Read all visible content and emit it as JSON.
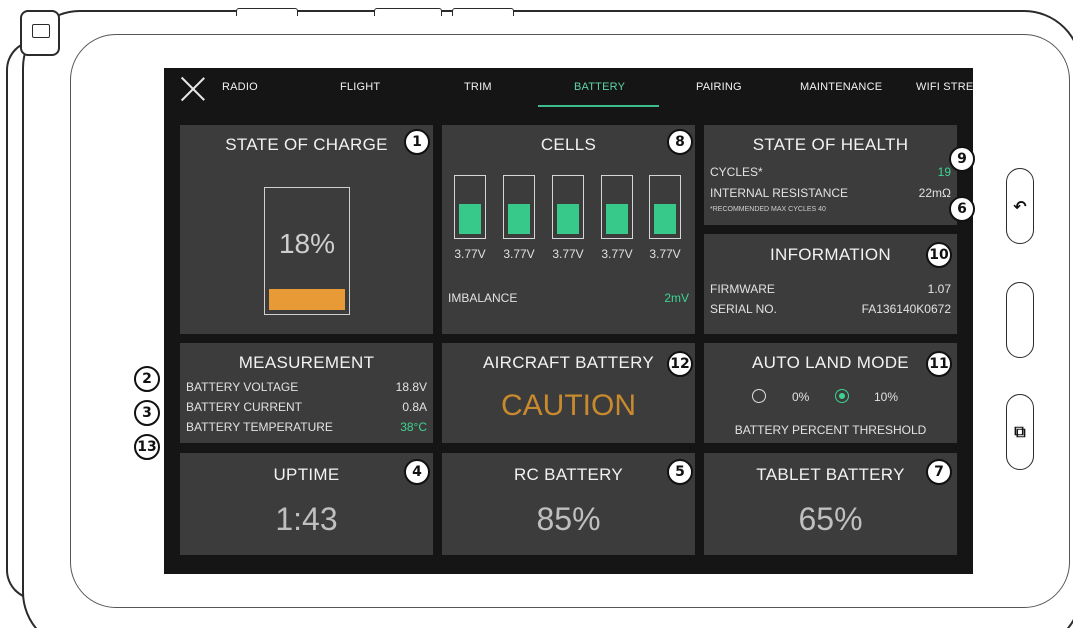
{
  "nav": {
    "tabs": [
      {
        "label": "RADIO",
        "active": false
      },
      {
        "label": "FLIGHT",
        "active": false
      },
      {
        "label": "TRIM",
        "active": false
      },
      {
        "label": "BATTERY",
        "active": true
      },
      {
        "label": "PAIRING",
        "active": false
      },
      {
        "label": "MAINTENANCE",
        "active": false
      },
      {
        "label": "WIFI STREA",
        "active": false
      }
    ]
  },
  "state_of_charge": {
    "title": "STATE OF CHARGE",
    "value": "18%",
    "level": 0.18
  },
  "cells": {
    "title": "CELLS",
    "voltages": [
      "3.77V",
      "3.77V",
      "3.77V",
      "3.77V",
      "3.77V"
    ],
    "fill_level": 0.55,
    "imbalance_label": "IMBALANCE",
    "imbalance_value": "2mV"
  },
  "state_of_health": {
    "title": "STATE OF HEALTH",
    "cycles_label": "CYCLES*",
    "cycles_value": "19",
    "resistance_label": "INTERNAL RESISTANCE",
    "resistance_value": "22mΩ",
    "footnote": "*RECOMMENDED MAX CYCLES 40"
  },
  "information": {
    "title": "INFORMATION",
    "firmware_label": "FIRMWARE",
    "firmware_value": "1.07",
    "serial_label": "SERIAL NO.",
    "serial_value": "FA136140K0672"
  },
  "measurement": {
    "title": "MEASUREMENT",
    "voltage_label": "BATTERY VOLTAGE",
    "voltage_value": "18.8V",
    "current_label": "BATTERY CURRENT",
    "current_value": "0.8A",
    "temp_label": "BATTERY TEMPERATURE",
    "temp_value": "38°C"
  },
  "aircraft_battery": {
    "title": "AIRCRAFT BATTERY",
    "status": "CAUTION"
  },
  "auto_land": {
    "title": "AUTO LAND MODE",
    "option_0": "0%",
    "option_1": "10%",
    "selected": "10%",
    "caption": "BATTERY PERCENT THRESHOLD"
  },
  "uptime": {
    "title": "UPTIME",
    "value": "1:43"
  },
  "rc_battery": {
    "title": "RC BATTERY",
    "value": "85%"
  },
  "tablet_battery": {
    "title": "TABLET BATTERY",
    "value": "65%"
  },
  "callouts": [
    "1",
    "2",
    "3",
    "4",
    "5",
    "6",
    "7",
    "8",
    "9",
    "10",
    "11",
    "12",
    "13"
  ],
  "side_buttons": {
    "back_icon": "back-arrow-icon",
    "copy_icon": "copy-icon",
    "back_glyph": "↶",
    "copy_glyph": "⧉"
  },
  "colors": {
    "accent_green": "#3dd492",
    "charge_orange": "#e89a37",
    "caution_orange": "#c98a2e",
    "panel": "#3c3c3c",
    "screen": "#151515"
  }
}
